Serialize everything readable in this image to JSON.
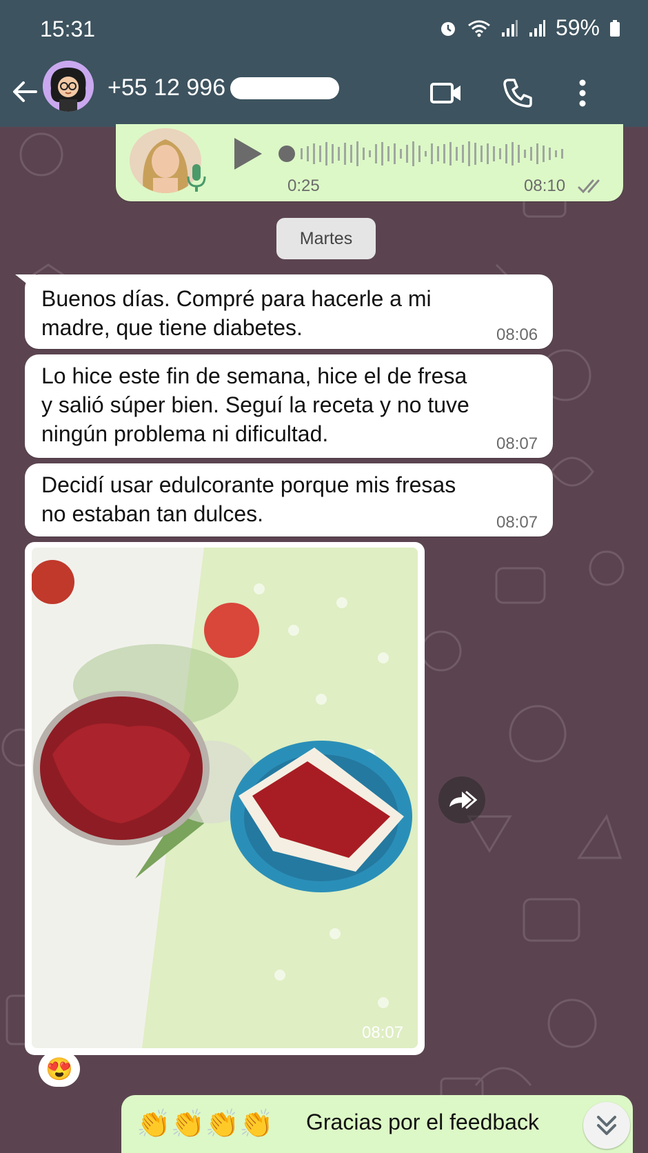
{
  "status_bar": {
    "time": "15:31",
    "battery": "59%"
  },
  "header": {
    "contact": "+55 12 996"
  },
  "voice_message": {
    "duration": "0:25",
    "time": "08:10"
  },
  "date_divider": "Martes",
  "messages": [
    {
      "text": "Buenos días. Compré para hacerle a mi\nmadre, que tiene diabetes.",
      "time": "08:06"
    },
    {
      "text": "Lo hice este fin de semana, hice el de fresa\ny salió súper bien. Seguí la receta y no tuve\nningún problema ni dificultad.",
      "time": "08:07"
    },
    {
      "text": "Decidí usar edulcorante porque mis fresas\nno estaban tan dulces.",
      "time": "08:07"
    }
  ],
  "image_message": {
    "time": "08:07"
  },
  "reaction": "😍",
  "reply": {
    "emojis": "👏👏👏👏",
    "text": "Gracias por el feedback"
  },
  "colors": {
    "header": "#3d535f",
    "chat_bg": "#5b4450",
    "incoming": "#ffffff",
    "outgoing": "#dcf8c6"
  }
}
